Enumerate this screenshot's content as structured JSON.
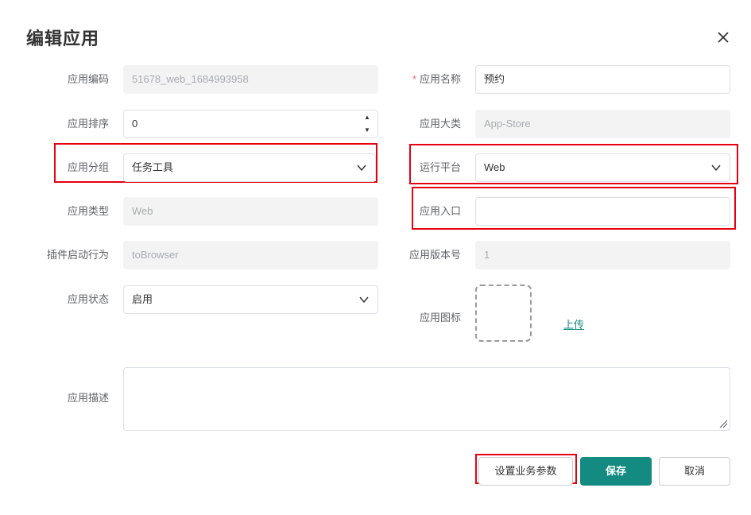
{
  "dialog": {
    "title": "编辑应用"
  },
  "form": {
    "app_code": {
      "label": "应用编码",
      "value": "51678_web_1684993958"
    },
    "app_name": {
      "required_mark": "*",
      "label": "应用名称",
      "value": "预约"
    },
    "app_order": {
      "label": "应用排序",
      "value": "0"
    },
    "app_category": {
      "label": "应用大类",
      "value": "App-Store"
    },
    "app_group": {
      "label": "应用分组",
      "value": "任务工具"
    },
    "platform": {
      "label": "运行平台",
      "value": "Web"
    },
    "app_type": {
      "label": "应用类型",
      "value": "Web"
    },
    "app_entry": {
      "label": "应用入口",
      "value": ""
    },
    "plugin_behavior": {
      "label": "插件启动行为",
      "value": "toBrowser"
    },
    "app_version": {
      "label": "应用版本号",
      "value": "1"
    },
    "app_status": {
      "label": "应用状态",
      "value": "启用"
    },
    "app_icon": {
      "label": "应用图标",
      "upload_label": "上传"
    },
    "app_desc": {
      "label": "应用描述",
      "value": ""
    }
  },
  "footer": {
    "biz_params_label": "设置业务参数",
    "save_label": "保存",
    "cancel_label": "取消"
  },
  "colors": {
    "accent": "#138b80",
    "highlight": "#e60012",
    "required": "#f56c6c"
  },
  "icons": {
    "close": "close-icon",
    "dropdown": "chevron-down-icon",
    "stepper": "stepper-arrows-icon",
    "resize": "resize-handle-icon"
  }
}
